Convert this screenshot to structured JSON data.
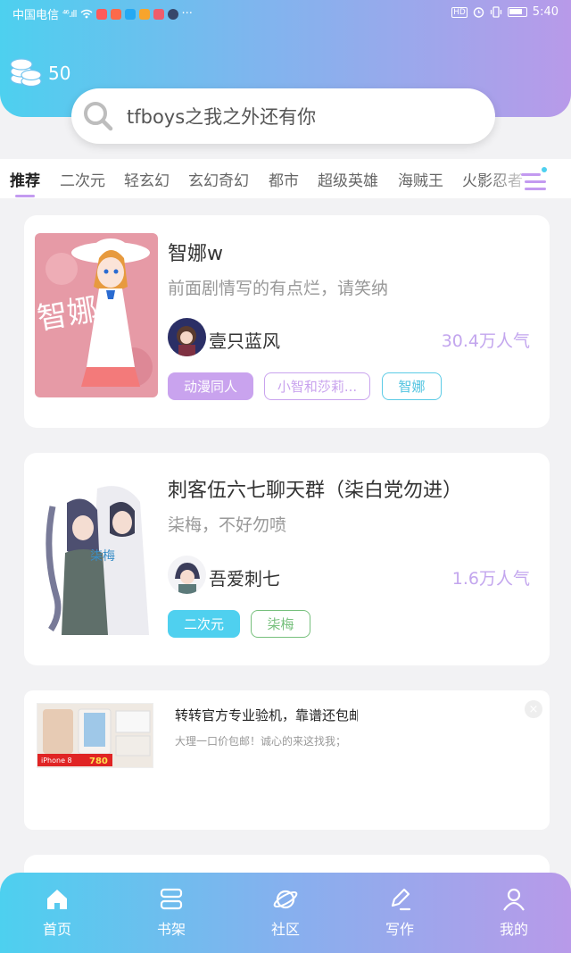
{
  "status_bar": {
    "carrier": "中国电信",
    "signal": "⁴⁶.ıll",
    "hd_label": "HD",
    "time": "5:40"
  },
  "header": {
    "coins": "50"
  },
  "search": {
    "text": "tfboys之我之外还有你"
  },
  "tabs": [
    {
      "label": "推荐",
      "active": true
    },
    {
      "label": "二次元"
    },
    {
      "label": "轻玄幻"
    },
    {
      "label": "玄幻奇幻"
    },
    {
      "label": "都市"
    },
    {
      "label": "超级英雄"
    },
    {
      "label": "海贼王"
    },
    {
      "label": "火影忍者"
    }
  ],
  "stories": [
    {
      "title": "智娜w",
      "subtitle": "前面剧情写的有点烂，请笑纳",
      "author": "壹只蓝风",
      "popularity": "30.4万人气",
      "cover_text": "智娜",
      "tags": [
        {
          "label": "动漫同人",
          "style": "filled",
          "color": "#c9a3ee"
        },
        {
          "label": "小智和莎莉...",
          "style": "outline",
          "color": "#c9a3ee"
        },
        {
          "label": "智娜",
          "style": "outline",
          "color": "#5ccbe6"
        }
      ]
    },
    {
      "title": "刺客伍六七聊天群（柒白党勿进）",
      "subtitle": "柒梅，不好勿喷",
      "author": "吾爱刺七",
      "popularity": "1.6万人气",
      "cover_text": "柒梅",
      "tags": [
        {
          "label": "二次元",
          "style": "filled",
          "color": "#4fd0ef"
        },
        {
          "label": "柒梅",
          "style": "outline",
          "color": "#77c07d"
        }
      ]
    }
  ],
  "ad": {
    "title": "转转官方专业验机，靠谱还包邮",
    "description": "大理一口价包邮！诚心的来这找我；",
    "image_caption": "iPhone 8",
    "image_price": "780",
    "close_icon": "×"
  },
  "bottom_nav": [
    {
      "label": "首页",
      "icon": "home-icon"
    },
    {
      "label": "书架",
      "icon": "bookshelf-icon"
    },
    {
      "label": "社区",
      "icon": "planet-icon"
    },
    {
      "label": "写作",
      "icon": "pen-icon"
    },
    {
      "label": "我的",
      "icon": "user-icon"
    }
  ]
}
